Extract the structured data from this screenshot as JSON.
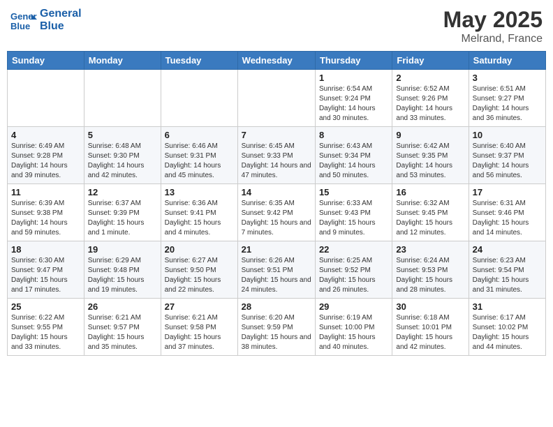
{
  "header": {
    "logo_general": "General",
    "logo_blue": "Blue",
    "month_year": "May 2025",
    "location": "Melrand, France"
  },
  "weekdays": [
    "Sunday",
    "Monday",
    "Tuesday",
    "Wednesday",
    "Thursday",
    "Friday",
    "Saturday"
  ],
  "weeks": [
    [
      {
        "day": "",
        "info": ""
      },
      {
        "day": "",
        "info": ""
      },
      {
        "day": "",
        "info": ""
      },
      {
        "day": "",
        "info": ""
      },
      {
        "day": "1",
        "info": "Sunrise: 6:54 AM\nSunset: 9:24 PM\nDaylight: 14 hours and 30 minutes."
      },
      {
        "day": "2",
        "info": "Sunrise: 6:52 AM\nSunset: 9:26 PM\nDaylight: 14 hours and 33 minutes."
      },
      {
        "day": "3",
        "info": "Sunrise: 6:51 AM\nSunset: 9:27 PM\nDaylight: 14 hours and 36 minutes."
      }
    ],
    [
      {
        "day": "4",
        "info": "Sunrise: 6:49 AM\nSunset: 9:28 PM\nDaylight: 14 hours and 39 minutes."
      },
      {
        "day": "5",
        "info": "Sunrise: 6:48 AM\nSunset: 9:30 PM\nDaylight: 14 hours and 42 minutes."
      },
      {
        "day": "6",
        "info": "Sunrise: 6:46 AM\nSunset: 9:31 PM\nDaylight: 14 hours and 45 minutes."
      },
      {
        "day": "7",
        "info": "Sunrise: 6:45 AM\nSunset: 9:33 PM\nDaylight: 14 hours and 47 minutes."
      },
      {
        "day": "8",
        "info": "Sunrise: 6:43 AM\nSunset: 9:34 PM\nDaylight: 14 hours and 50 minutes."
      },
      {
        "day": "9",
        "info": "Sunrise: 6:42 AM\nSunset: 9:35 PM\nDaylight: 14 hours and 53 minutes."
      },
      {
        "day": "10",
        "info": "Sunrise: 6:40 AM\nSunset: 9:37 PM\nDaylight: 14 hours and 56 minutes."
      }
    ],
    [
      {
        "day": "11",
        "info": "Sunrise: 6:39 AM\nSunset: 9:38 PM\nDaylight: 14 hours and 59 minutes."
      },
      {
        "day": "12",
        "info": "Sunrise: 6:37 AM\nSunset: 9:39 PM\nDaylight: 15 hours and 1 minute."
      },
      {
        "day": "13",
        "info": "Sunrise: 6:36 AM\nSunset: 9:41 PM\nDaylight: 15 hours and 4 minutes."
      },
      {
        "day": "14",
        "info": "Sunrise: 6:35 AM\nSunset: 9:42 PM\nDaylight: 15 hours and 7 minutes."
      },
      {
        "day": "15",
        "info": "Sunrise: 6:33 AM\nSunset: 9:43 PM\nDaylight: 15 hours and 9 minutes."
      },
      {
        "day": "16",
        "info": "Sunrise: 6:32 AM\nSunset: 9:45 PM\nDaylight: 15 hours and 12 minutes."
      },
      {
        "day": "17",
        "info": "Sunrise: 6:31 AM\nSunset: 9:46 PM\nDaylight: 15 hours and 14 minutes."
      }
    ],
    [
      {
        "day": "18",
        "info": "Sunrise: 6:30 AM\nSunset: 9:47 PM\nDaylight: 15 hours and 17 minutes."
      },
      {
        "day": "19",
        "info": "Sunrise: 6:29 AM\nSunset: 9:48 PM\nDaylight: 15 hours and 19 minutes."
      },
      {
        "day": "20",
        "info": "Sunrise: 6:27 AM\nSunset: 9:50 PM\nDaylight: 15 hours and 22 minutes."
      },
      {
        "day": "21",
        "info": "Sunrise: 6:26 AM\nSunset: 9:51 PM\nDaylight: 15 hours and 24 minutes."
      },
      {
        "day": "22",
        "info": "Sunrise: 6:25 AM\nSunset: 9:52 PM\nDaylight: 15 hours and 26 minutes."
      },
      {
        "day": "23",
        "info": "Sunrise: 6:24 AM\nSunset: 9:53 PM\nDaylight: 15 hours and 28 minutes."
      },
      {
        "day": "24",
        "info": "Sunrise: 6:23 AM\nSunset: 9:54 PM\nDaylight: 15 hours and 31 minutes."
      }
    ],
    [
      {
        "day": "25",
        "info": "Sunrise: 6:22 AM\nSunset: 9:55 PM\nDaylight: 15 hours and 33 minutes."
      },
      {
        "day": "26",
        "info": "Sunrise: 6:21 AM\nSunset: 9:57 PM\nDaylight: 15 hours and 35 minutes."
      },
      {
        "day": "27",
        "info": "Sunrise: 6:21 AM\nSunset: 9:58 PM\nDaylight: 15 hours and 37 minutes."
      },
      {
        "day": "28",
        "info": "Sunrise: 6:20 AM\nSunset: 9:59 PM\nDaylight: 15 hours and 38 minutes."
      },
      {
        "day": "29",
        "info": "Sunrise: 6:19 AM\nSunset: 10:00 PM\nDaylight: 15 hours and 40 minutes."
      },
      {
        "day": "30",
        "info": "Sunrise: 6:18 AM\nSunset: 10:01 PM\nDaylight: 15 hours and 42 minutes."
      },
      {
        "day": "31",
        "info": "Sunrise: 6:17 AM\nSunset: 10:02 PM\nDaylight: 15 hours and 44 minutes."
      }
    ]
  ]
}
